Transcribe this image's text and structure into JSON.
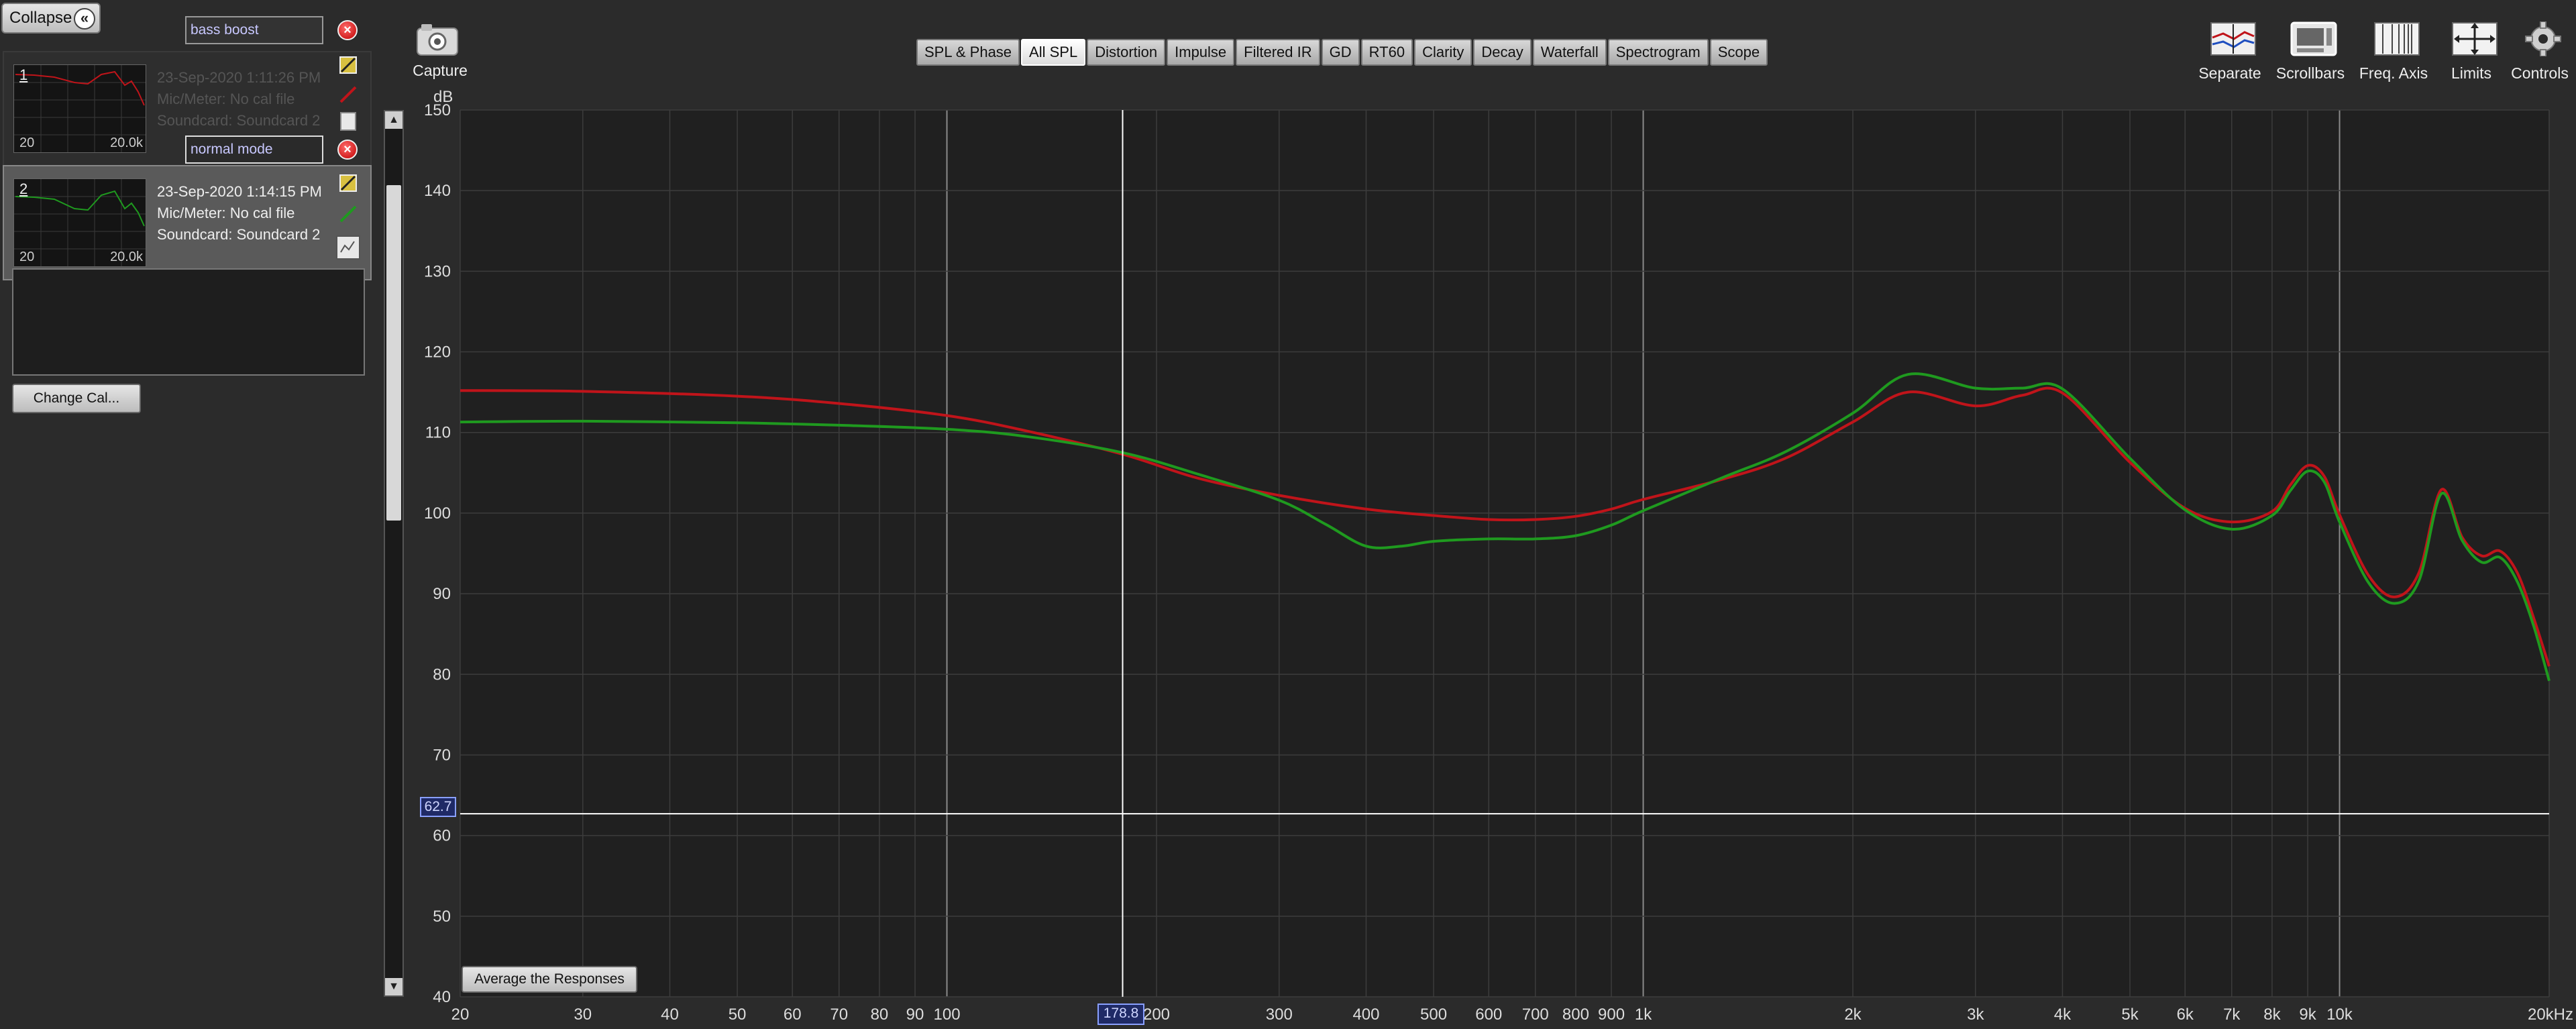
{
  "panel": {
    "collapse_label": "Collapse",
    "change_cal_label": "Change Cal...",
    "measurements": [
      {
        "index": "1",
        "name": "bass boost",
        "date": "23-Sep-2020 1:11:26 PM",
        "mic": "Mic/Meter: No cal file",
        "soundcard": "Soundcard: Soundcard 2",
        "thumb_min": "20",
        "thumb_max": "20.0k",
        "color": "#c0141a"
      },
      {
        "index": "2",
        "name": "normal mode",
        "date": "23-Sep-2020 1:14:15 PM",
        "mic": "Mic/Meter: No cal file",
        "soundcard": "Soundcard: Soundcard 2",
        "thumb_min": "20",
        "thumb_max": "20.0k",
        "color": "#1f9a1f"
      }
    ]
  },
  "toolbar": {
    "capture_label": "Capture",
    "tabs": [
      "SPL & Phase",
      "All SPL",
      "Distortion",
      "Impulse",
      "Filtered IR",
      "GD",
      "RT60",
      "Clarity",
      "Decay",
      "Waterfall",
      "Spectrogram",
      "Scope"
    ],
    "active_tab": "All SPL",
    "right_tools": [
      "Separate",
      "Scrollbars",
      "Freq. Axis",
      "Limits",
      "Controls"
    ]
  },
  "graph": {
    "y_unit": "dB",
    "avg_button_label": "Average the Responses",
    "cursor_y_value": "62.7",
    "cursor_x_value": "178.8"
  },
  "chart_data": {
    "type": "line",
    "title": "",
    "xlabel": "",
    "ylabel": "dB",
    "x_scale": "log",
    "xlim": [
      20,
      20000
    ],
    "ylim": [
      40,
      150
    ],
    "grid": true,
    "y_ticks": [
      40,
      50,
      60,
      70,
      80,
      90,
      100,
      110,
      120,
      130,
      140,
      150
    ],
    "x_ticks": [
      {
        "v": 20,
        "label": "20"
      },
      {
        "v": 30,
        "label": "30"
      },
      {
        "v": 40,
        "label": "40"
      },
      {
        "v": 50,
        "label": "50"
      },
      {
        "v": 60,
        "label": "60"
      },
      {
        "v": 70,
        "label": "70"
      },
      {
        "v": 80,
        "label": "80"
      },
      {
        "v": 90,
        "label": "90"
      },
      {
        "v": 100,
        "label": "100"
      },
      {
        "v": 200,
        "label": "200"
      },
      {
        "v": 300,
        "label": "300"
      },
      {
        "v": 400,
        "label": "400"
      },
      {
        "v": 500,
        "label": "500"
      },
      {
        "v": 600,
        "label": "600"
      },
      {
        "v": 700,
        "label": "700"
      },
      {
        "v": 800,
        "label": "800"
      },
      {
        "v": 900,
        "label": "900"
      },
      {
        "v": 1000,
        "label": "1k"
      },
      {
        "v": 2000,
        "label": "2k"
      },
      {
        "v": 3000,
        "label": "3k"
      },
      {
        "v": 4000,
        "label": "4k"
      },
      {
        "v": 5000,
        "label": "5k"
      },
      {
        "v": 6000,
        "label": "6k"
      },
      {
        "v": 7000,
        "label": "7k"
      },
      {
        "v": 8000,
        "label": "8k"
      },
      {
        "v": 9000,
        "label": "9k"
      },
      {
        "v": 10000,
        "label": "10k"
      },
      {
        "v": 20000,
        "label": "20kHz"
      }
    ],
    "cursor": {
      "x": 178.8,
      "y": 62.7
    },
    "series": [
      {
        "color": "#c0141a",
        "x": [
          20,
          30,
          50,
          70,
          100,
          130,
          178.8,
          230,
          300,
          400,
          500,
          600,
          700,
          800,
          900,
          1000,
          1300,
          1600,
          2000,
          2400,
          3000,
          3500,
          4000,
          5000,
          6000,
          7000,
          8000,
          8500,
          9000,
          9500,
          10000,
          11000,
          12000,
          13000,
          14000,
          15000,
          16000,
          17000,
          18000,
          19000,
          20000
        ],
        "y": [
          115.2,
          115.1,
          114.5,
          113.6,
          112.1,
          110.2,
          107.3,
          104.3,
          102.2,
          100.5,
          99.7,
          99.2,
          99.2,
          99.6,
          100.5,
          101.7,
          104.2,
          106.8,
          111.3,
          115.0,
          113.3,
          114.6,
          114.9,
          106.3,
          100.6,
          98.9,
          100.2,
          103.5,
          105.9,
          104.6,
          99.8,
          92.3,
          89.6,
          92.6,
          102.9,
          97.0,
          94.7,
          95.3,
          92.6,
          87.0,
          81.0
        ]
      },
      {
        "color": "#1f9a1f",
        "x": [
          20,
          30,
          50,
          70,
          100,
          130,
          178.8,
          230,
          300,
          350,
          400,
          450,
          500,
          600,
          700,
          800,
          900,
          1000,
          1300,
          1600,
          2000,
          2400,
          3000,
          3500,
          4000,
          5000,
          6000,
          7000,
          8000,
          8500,
          9000,
          9500,
          10000,
          11000,
          12000,
          13000,
          14000,
          15000,
          16000,
          17000,
          18000,
          19000,
          20000
        ],
        "y": [
          111.3,
          111.4,
          111.2,
          110.9,
          110.4,
          109.5,
          107.5,
          104.8,
          101.6,
          98.6,
          95.9,
          95.9,
          96.5,
          96.8,
          96.8,
          97.2,
          98.5,
          100.3,
          104.4,
          107.6,
          112.4,
          117.2,
          115.5,
          115.5,
          115.4,
          106.8,
          100.4,
          98.0,
          99.7,
          102.8,
          105.2,
          103.9,
          98.9,
          91.4,
          88.8,
          91.6,
          102.4,
          96.6,
          93.9,
          94.5,
          91.5,
          86.0,
          79.2
        ]
      }
    ]
  }
}
